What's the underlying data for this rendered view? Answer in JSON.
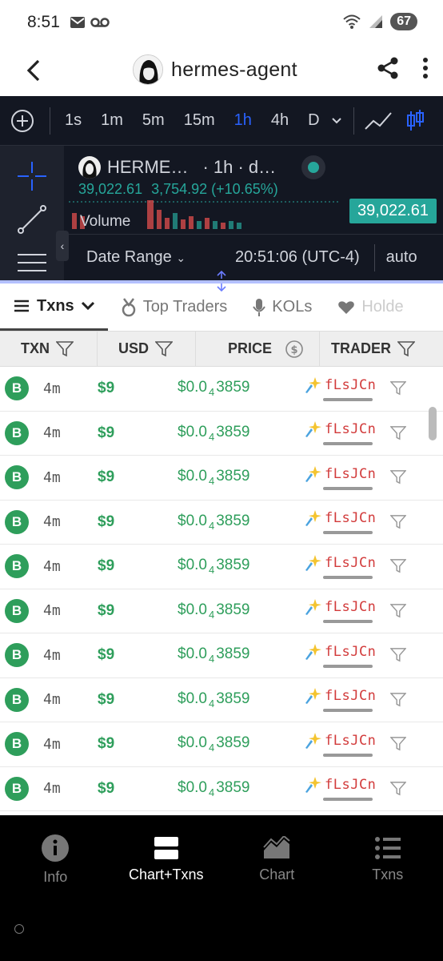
{
  "status": {
    "time": "8:51",
    "battery": "67"
  },
  "header": {
    "title": "hermes-agent"
  },
  "chart_toolbar": {
    "timeframes": [
      "1s",
      "1m",
      "5m",
      "15m",
      "1h",
      "4h",
      "D"
    ],
    "active": "1h"
  },
  "chart": {
    "symbol": "HERME…",
    "interval": "· 1h · d…",
    "ohlc_left": "39,022.61",
    "ohlc_change": "3,754.92 (+10.65%)",
    "price_tag": "39,022.61",
    "volume_label": "Volume",
    "date_range_label": "Date Range",
    "time_label": "20:51:06 (UTC-4)",
    "scale_label": "auto",
    "colors": {
      "bg": "#131722",
      "up": "#26a69a",
      "down": "#ef5350"
    }
  },
  "tabs": [
    {
      "label": "Txns",
      "icon": "list-icon",
      "active": true
    },
    {
      "label": "Top Traders",
      "icon": "medal-icon",
      "active": false
    },
    {
      "label": "KOLs",
      "icon": "mic-icon",
      "active": false
    },
    {
      "label": "Holde",
      "icon": "heart-icon",
      "active": false
    }
  ],
  "table": {
    "headers": {
      "txn": "TXN",
      "usd": "USD",
      "price": "PRICE",
      "trader": "TRADER"
    },
    "rows": [
      {
        "type": "B",
        "age": "4m",
        "usd": "$9",
        "price_prefix": "$0.0",
        "price_zeros": "4",
        "price_digits": "3859",
        "trader": "fLsJCn"
      },
      {
        "type": "B",
        "age": "4m",
        "usd": "$9",
        "price_prefix": "$0.0",
        "price_zeros": "4",
        "price_digits": "3859",
        "trader": "fLsJCn"
      },
      {
        "type": "B",
        "age": "4m",
        "usd": "$9",
        "price_prefix": "$0.0",
        "price_zeros": "4",
        "price_digits": "3859",
        "trader": "fLsJCn"
      },
      {
        "type": "B",
        "age": "4m",
        "usd": "$9",
        "price_prefix": "$0.0",
        "price_zeros": "4",
        "price_digits": "3859",
        "trader": "fLsJCn"
      },
      {
        "type": "B",
        "age": "4m",
        "usd": "$9",
        "price_prefix": "$0.0",
        "price_zeros": "4",
        "price_digits": "3859",
        "trader": "fLsJCn"
      },
      {
        "type": "B",
        "age": "4m",
        "usd": "$9",
        "price_prefix": "$0.0",
        "price_zeros": "4",
        "price_digits": "3859",
        "trader": "fLsJCn"
      },
      {
        "type": "B",
        "age": "4m",
        "usd": "$9",
        "price_prefix": "$0.0",
        "price_zeros": "4",
        "price_digits": "3859",
        "trader": "fLsJCn"
      },
      {
        "type": "B",
        "age": "4m",
        "usd": "$9",
        "price_prefix": "$0.0",
        "price_zeros": "4",
        "price_digits": "3859",
        "trader": "fLsJCn"
      },
      {
        "type": "B",
        "age": "4m",
        "usd": "$9",
        "price_prefix": "$0.0",
        "price_zeros": "4",
        "price_digits": "3859",
        "trader": "fLsJCn"
      },
      {
        "type": "B",
        "age": "4m",
        "usd": "$9",
        "price_prefix": "$0.0",
        "price_zeros": "4",
        "price_digits": "3859",
        "trader": "fLsJCn"
      }
    ]
  },
  "bottom_nav": [
    {
      "label": "Info",
      "icon": "info-icon",
      "active": false
    },
    {
      "label": "Chart+Txns",
      "icon": "split-view-icon",
      "active": true
    },
    {
      "label": "Chart",
      "icon": "area-chart-icon",
      "active": false
    },
    {
      "label": "Txns",
      "icon": "list-icon",
      "active": false
    }
  ]
}
